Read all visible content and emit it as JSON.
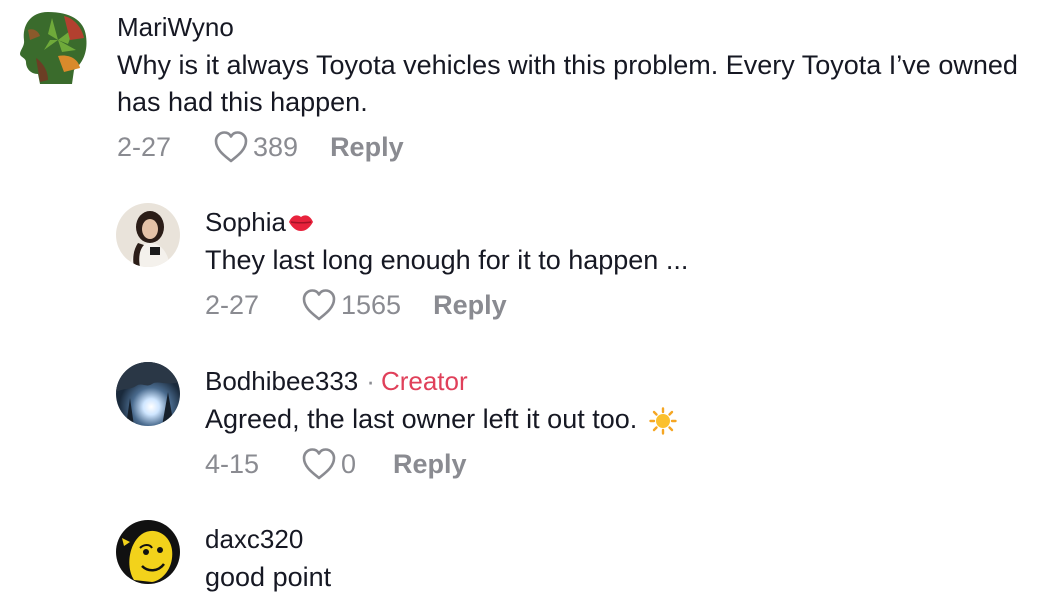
{
  "comments": [
    {
      "username": "MariWyno",
      "text": "Why is it always Toyota vehicles with this problem. Every Toyota I’ve owned has had this happen.",
      "date": "2-27",
      "likes": "389",
      "reply_label": "Reply"
    },
    {
      "username": "Sophia",
      "username_emoji": "lips-icon",
      "text": "They last long enough for it to happen ...",
      "date": "2-27",
      "likes": "1565",
      "reply_label": "Reply"
    },
    {
      "username": "Bodhibee333",
      "separator": "·",
      "badge": "Creator",
      "text": "Agreed, the last owner left it out too.",
      "text_emoji": "sun-icon",
      "date": "4-15",
      "likes": "0",
      "reply_label": "Reply"
    },
    {
      "username": "daxc320",
      "text": "good point"
    }
  ],
  "colors": {
    "text_primary": "#161823",
    "text_secondary": "#8a8b91",
    "creator_badge": "#e0405a"
  }
}
